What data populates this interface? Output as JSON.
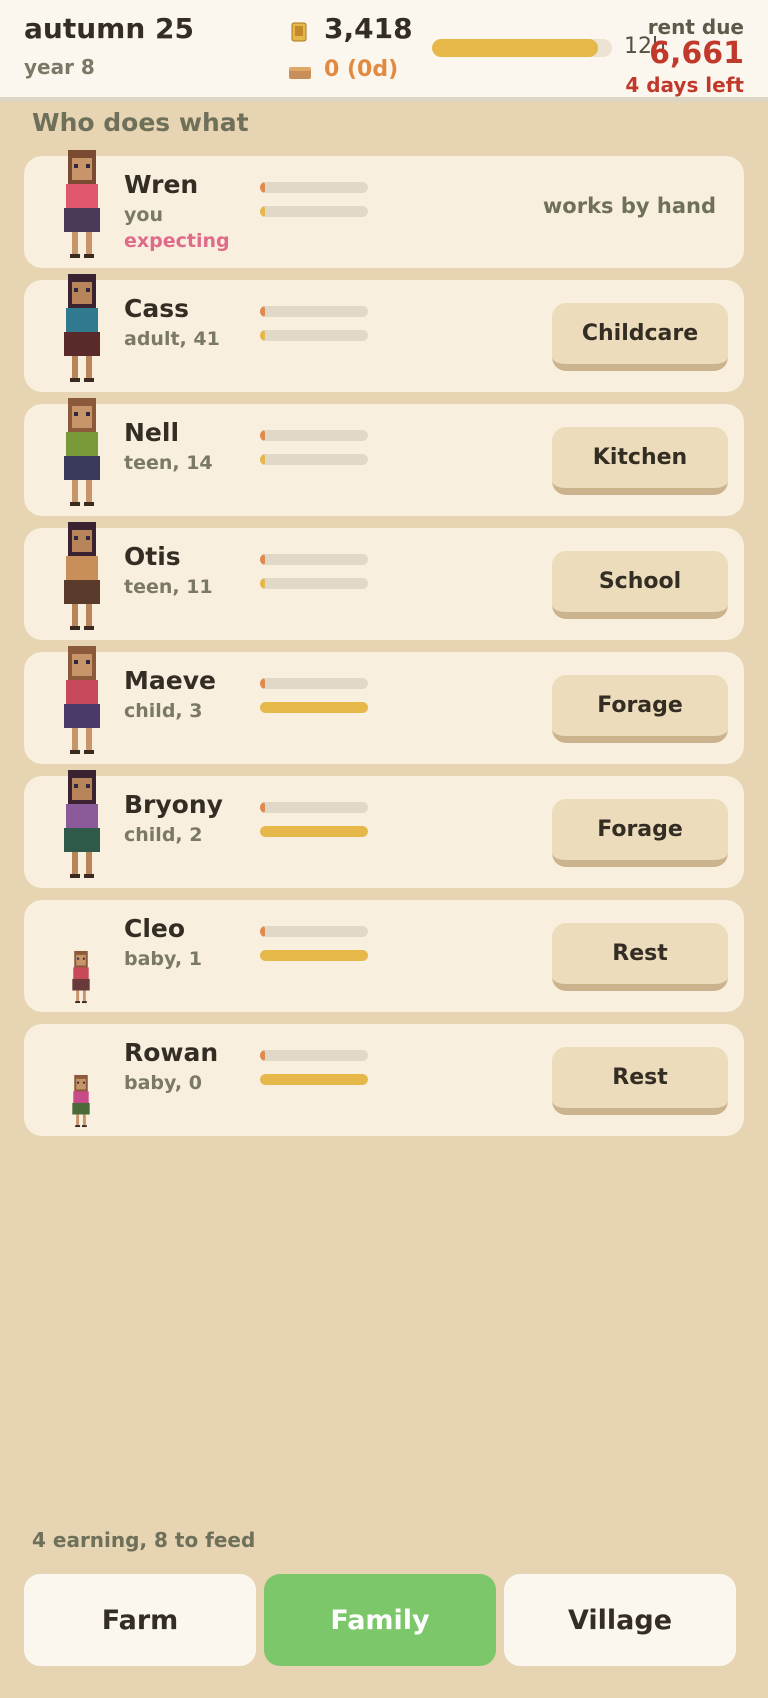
{
  "header": {
    "season": "autumn 25",
    "year": "year 8",
    "coins": "3,418",
    "food": "0 (0d)",
    "day_progress": 0.92,
    "hours_label": "12h",
    "rent_label": "rent due",
    "rent_amount": "6,661",
    "rent_days": "4 days left"
  },
  "section_title": "Who does what",
  "members": [
    {
      "name": "Wren",
      "sub": "you",
      "extra": "expecting",
      "bar1": 0.05,
      "bar2": 0.05,
      "status": "works by hand",
      "job": null
    },
    {
      "name": "Cass",
      "sub": "adult, 41",
      "bar1": 0.05,
      "bar2": 0.05,
      "job": "Childcare"
    },
    {
      "name": "Nell",
      "sub": "teen, 14",
      "bar1": 0.05,
      "bar2": 0.05,
      "job": "Kitchen"
    },
    {
      "name": "Otis",
      "sub": "teen, 11",
      "bar1": 0.05,
      "bar2": 0.05,
      "job": "School"
    },
    {
      "name": "Maeve",
      "sub": "child, 3",
      "bar1": 0.05,
      "bar2": 1.0,
      "job": "Forage"
    },
    {
      "name": "Bryony",
      "sub": "child, 2",
      "bar1": 0.05,
      "bar2": 1.0,
      "job": "Forage"
    },
    {
      "name": "Cleo",
      "sub": "baby, 1",
      "bar1": 0.05,
      "bar2": 1.0,
      "job": "Rest"
    },
    {
      "name": "Rowan",
      "sub": "baby, 0",
      "bar1": 0.05,
      "bar2": 1.0,
      "job": "Rest"
    }
  ],
  "footer": {
    "summary": "4 earning, 8 to feed"
  },
  "nav": {
    "farm": "Farm",
    "family": "Family",
    "village": "Village",
    "active": "Family"
  },
  "colors": {
    "accent_green": "#7dc76b",
    "rent_red": "#c0392b",
    "bar_gold": "#e6b84a",
    "bar_orange": "#e08a4e",
    "expecting_pink": "#e06a8a"
  }
}
